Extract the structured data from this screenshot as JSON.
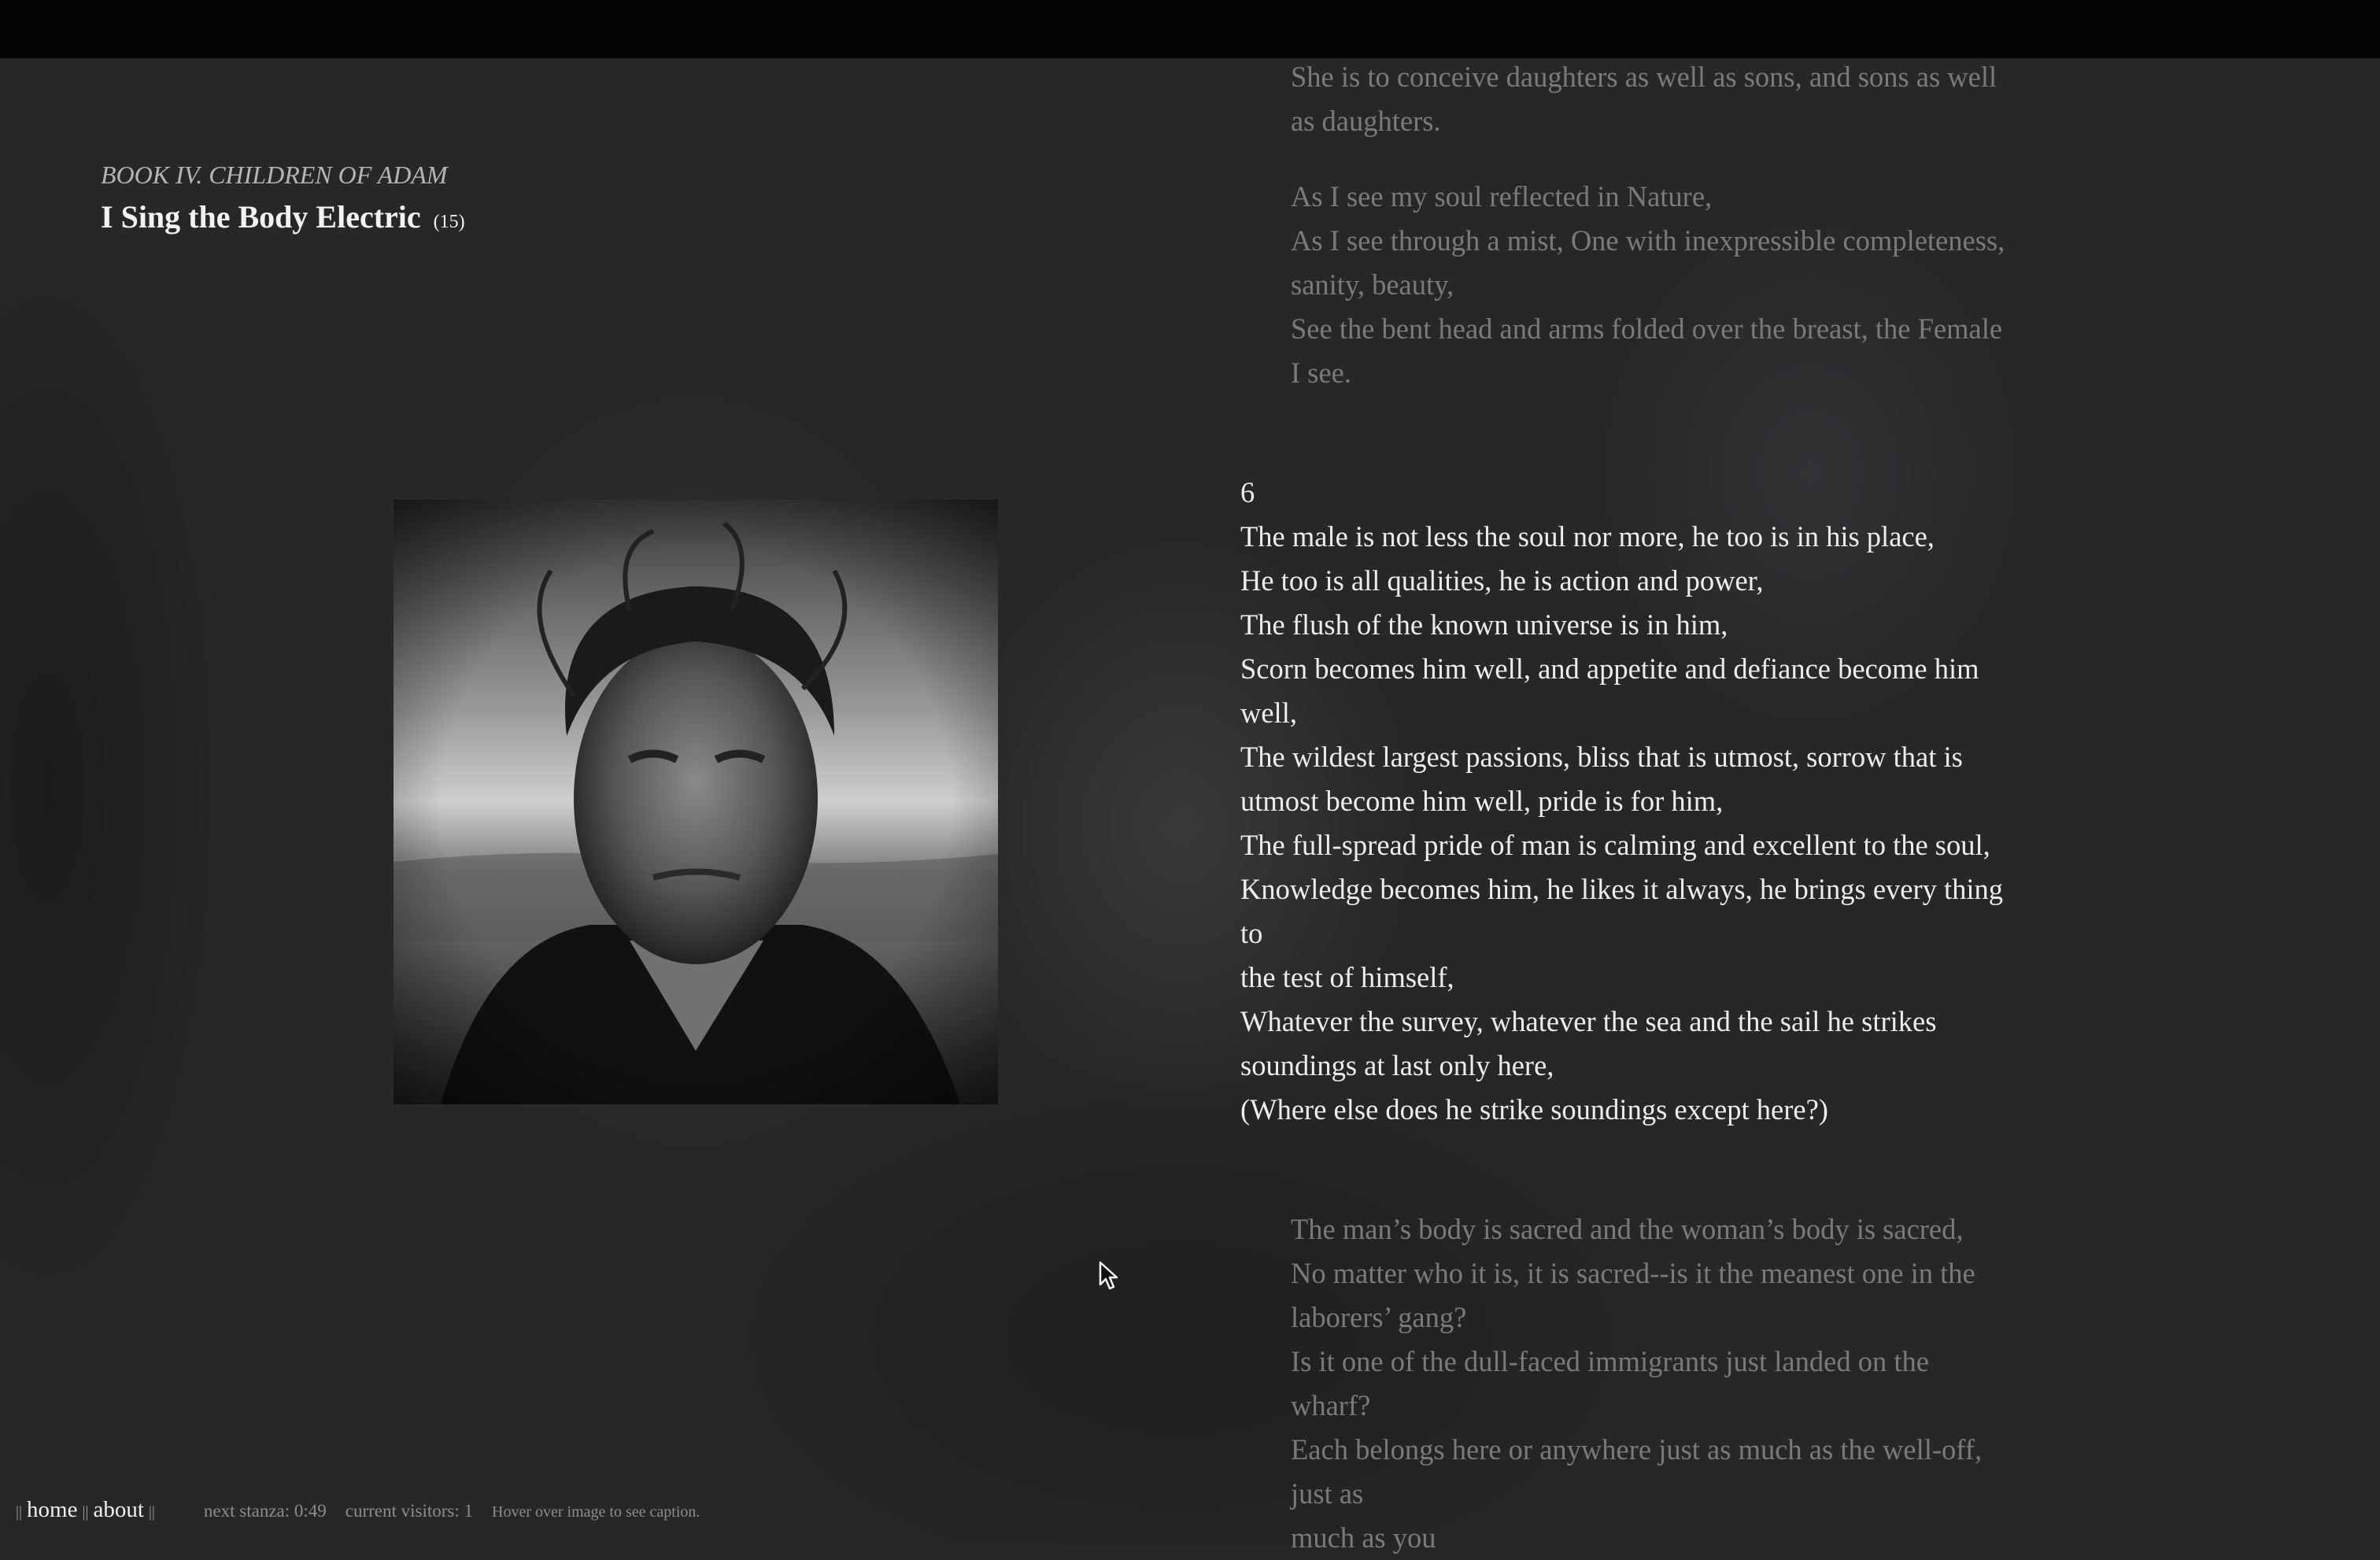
{
  "header": {
    "book": "BOOK IV. CHILDREN OF ADAM",
    "title": "I Sing the Body Electric",
    "title_number": "(15)"
  },
  "stanza_prev": {
    "group_a": [
      "She is to conceive daughters as well as sons, and sons as well",
      "as daughters."
    ],
    "group_b": [
      "As I see my soul reflected in Nature,",
      "As I see through a mist, One with inexpressible completeness,",
      "sanity, beauty,",
      "See the bent head and arms folded over the breast, the Female",
      "I see."
    ]
  },
  "stanza_current": {
    "number": "6",
    "lines": [
      "The male is not less the soul nor more, he too is in his place,",
      "He too is all qualities, he is action and power,",
      "The flush of the known universe is in him,",
      "Scorn becomes him well, and appetite and defiance become him",
      "well,",
      "The wildest largest passions, bliss that is utmost, sorrow that is",
      "utmost become him well, pride is for him,",
      "The full-spread pride of man is calming and excellent to the soul,",
      "Knowledge becomes him, he likes it always, he brings every thing",
      "to",
      "the test of himself,",
      "Whatever the survey, whatever the sea and the sail he strikes",
      "soundings at last only here,",
      "(Where else does he strike soundings except here?)"
    ]
  },
  "stanza_next": {
    "lines": [
      "The man’s body is sacred and the woman’s body is sacred,",
      "No matter who it is, it is sacred--is it the meanest one in the",
      "laborers’ gang?",
      "Is it one of the dull-faced immigrants just landed on the",
      "wharf?",
      "Each belongs here or anywhere just as much as the well-off,",
      "just as",
      "much as you"
    ]
  },
  "footer": {
    "separator": "||",
    "home": "home",
    "about": "about",
    "next_stanza": "next stanza: 0:49",
    "visitors": "current visitors: 1",
    "hint": "Hover over image to see caption."
  }
}
